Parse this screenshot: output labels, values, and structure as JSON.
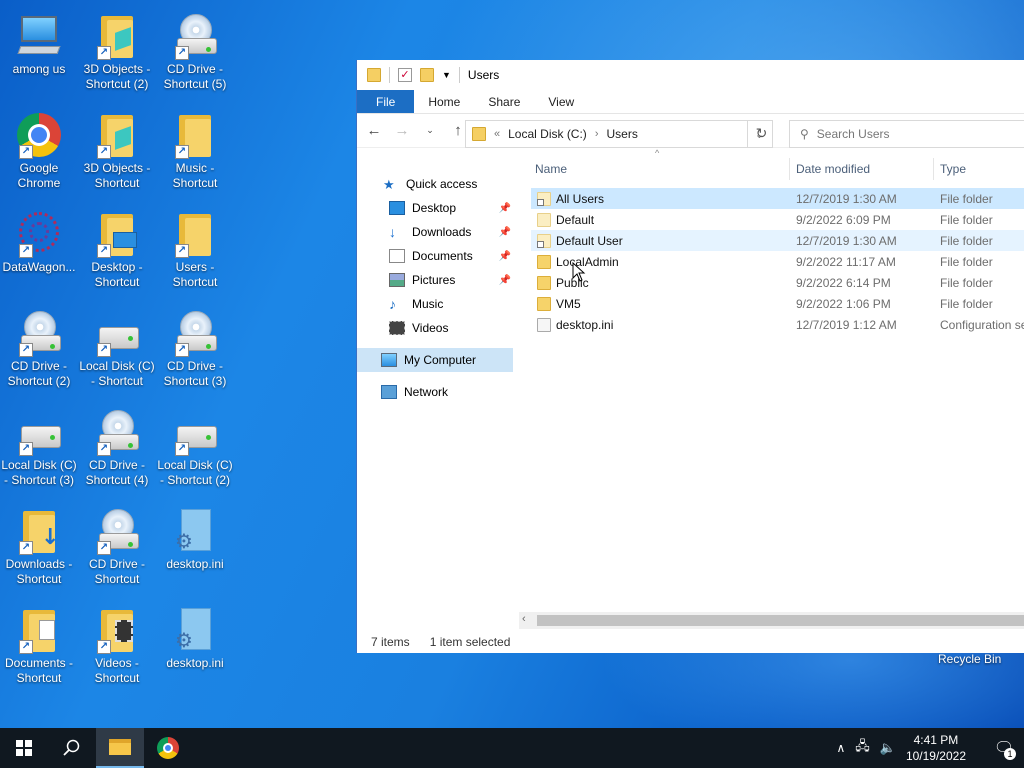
{
  "desktop_icons": [
    {
      "label": "among us",
      "icon": "computer-icon"
    },
    {
      "label": "3D Objects -\nShortcut (2)",
      "icon": "folder-3d-icon"
    },
    {
      "label": "CD Drive -\nShortcut (5)",
      "icon": "cd-drive-icon"
    },
    {
      "label": "Google\nChrome",
      "icon": "chrome-icon"
    },
    {
      "label": "3D Objects -\nShortcut",
      "icon": "folder-3d-icon"
    },
    {
      "label": "Music -\nShortcut",
      "icon": "folder-music-icon"
    },
    {
      "label": "DataWagon...",
      "icon": "datawagon-icon"
    },
    {
      "label": "Desktop -\nShortcut",
      "icon": "folder-desktop-icon"
    },
    {
      "label": "Users -\nShortcut",
      "icon": "folder-users-icon"
    },
    {
      "label": "CD Drive -\nShortcut (2)",
      "icon": "cd-drive-icon"
    },
    {
      "label": "Local Disk (C)\n- Shortcut",
      "icon": "local-disk-icon"
    },
    {
      "label": "CD Drive -\nShortcut (3)",
      "icon": "cd-drive-icon"
    },
    {
      "label": "Local Disk (C)\n- Shortcut (3)",
      "icon": "local-disk-icon"
    },
    {
      "label": "CD Drive -\nShortcut (4)",
      "icon": "cd-drive-icon"
    },
    {
      "label": "Local Disk (C)\n- Shortcut (2)",
      "icon": "local-disk-icon"
    },
    {
      "label": "Downloads -\nShortcut",
      "icon": "folder-downloads-icon"
    },
    {
      "label": "CD Drive -\nShortcut",
      "icon": "cd-drive-icon"
    },
    {
      "label": "desktop.ini",
      "icon": "settings-file-icon"
    },
    {
      "label": "Documents -\nShortcut",
      "icon": "folder-documents-icon"
    },
    {
      "label": "Videos -\nShortcut",
      "icon": "folder-videos-icon"
    },
    {
      "label": "desktop.ini",
      "icon": "settings-file-icon"
    }
  ],
  "explorer": {
    "title": "Users",
    "ribbon_tabs": [
      "File",
      "Home",
      "Share",
      "View"
    ],
    "address": {
      "prefix": "«",
      "crumbs": [
        "Local Disk (C:)",
        "Users"
      ]
    },
    "search_placeholder": "Search Users",
    "columns": {
      "name": "Name",
      "date": "Date modified",
      "type": "Type"
    },
    "nav": {
      "quick_access": "Quick access",
      "items": [
        "Desktop",
        "Downloads",
        "Documents",
        "Pictures",
        "Music",
        "Videos"
      ],
      "my_computer": "My Computer",
      "network": "Network"
    },
    "files": [
      {
        "name": "All Users",
        "date": "12/7/2019 1:30 AM",
        "type": "File folder",
        "kind": "link"
      },
      {
        "name": "Default",
        "date": "9/2/2022 6:09 PM",
        "type": "File folder",
        "kind": "light"
      },
      {
        "name": "Default User",
        "date": "12/7/2019 1:30 AM",
        "type": "File folder",
        "kind": "link"
      },
      {
        "name": "LocalAdmin",
        "date": "9/2/2022 11:17 AM",
        "type": "File folder",
        "kind": "folder"
      },
      {
        "name": "Public",
        "date": "9/2/2022 6:14 PM",
        "type": "File folder",
        "kind": "folder"
      },
      {
        "name": "VM5",
        "date": "9/2/2022 1:06 PM",
        "type": "File folder",
        "kind": "folder"
      },
      {
        "name": "desktop.ini",
        "date": "12/7/2019 1:12 AM",
        "type": "Configuration se",
        "kind": "doc"
      }
    ],
    "status": {
      "count": "7 items",
      "selected": "1 item selected"
    }
  },
  "recycle_bin": "Recycle Bin",
  "taskbar": {
    "time": "4:41 PM",
    "date": "10/19/2022",
    "notification_count": "1"
  },
  "colors": {
    "accent": "#1c6ec4",
    "selection": "#cce8ff",
    "desktop": "#1a80e0"
  }
}
